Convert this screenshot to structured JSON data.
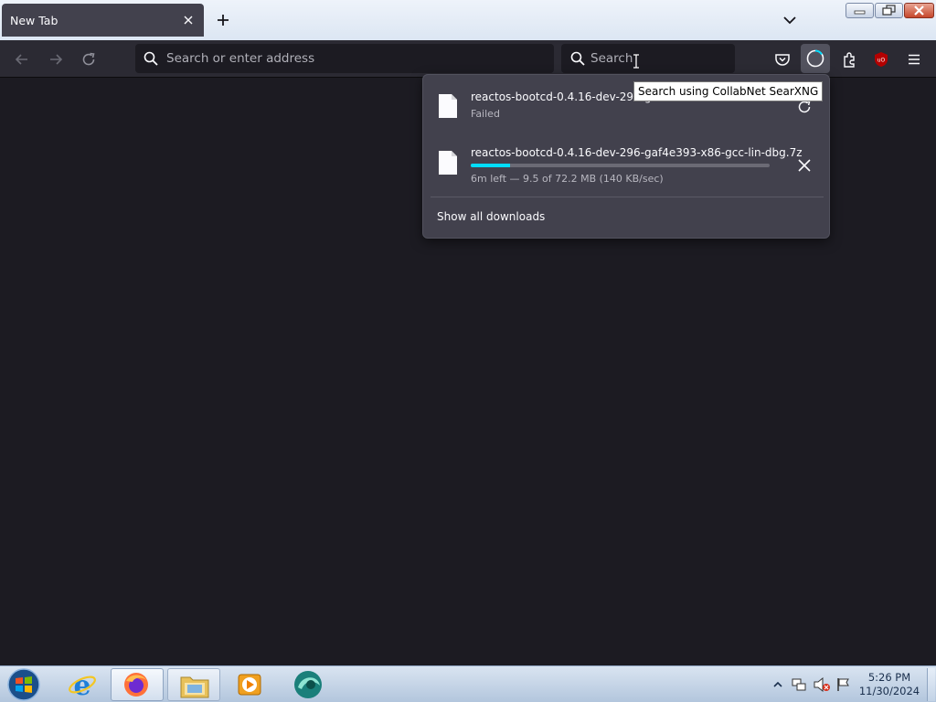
{
  "tab": {
    "title": "New Tab"
  },
  "toolbar": {
    "url_placeholder": "Search or enter address",
    "search_placeholder": "Search"
  },
  "tooltip": "Search using CollabNet SearXNG",
  "downloads": {
    "items": [
      {
        "name": "reactos-bootcd-0.4.16-dev-296-ga",
        "status": "Failed",
        "action": "retry-icon"
      },
      {
        "name": "reactos-bootcd-0.4.16-dev-296-gaf4e393-x86-gcc-lin-dbg.7z",
        "status": "6m left — 9.5 of 72.2 MB (140 KB/sec)",
        "progress": 0.13,
        "action": "cancel-icon"
      }
    ],
    "show_all": "Show all downloads"
  },
  "taskbar": {
    "apps": [
      "start-orb-icon",
      "internet-explorer-icon",
      "firefox-icon",
      "file-explorer-icon",
      "media-player-icon",
      "app-icon"
    ],
    "clock_time": "5:26 PM",
    "clock_date": "11/30/2024"
  },
  "colors": {
    "accent": "#00ddff",
    "panel": "#42414d",
    "toolbar": "#2b2a33",
    "content": "#1c1b22"
  }
}
